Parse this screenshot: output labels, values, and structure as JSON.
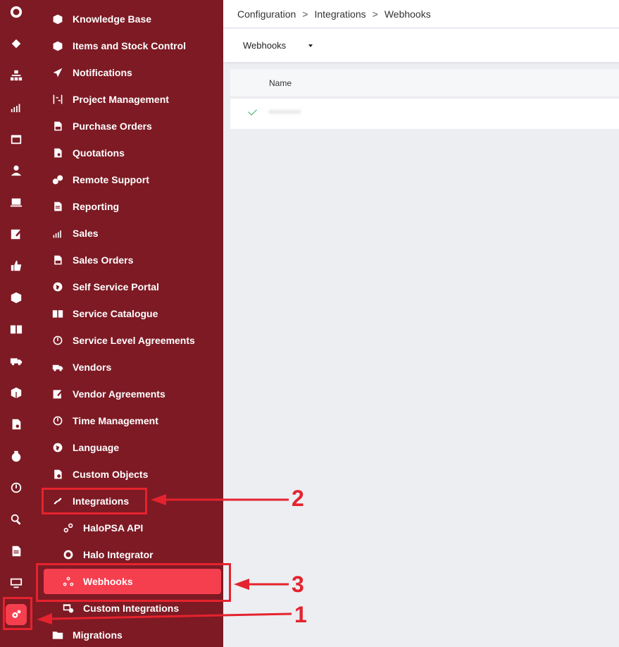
{
  "breadcrumb": [
    "Configuration",
    "Integrations",
    "Webhooks"
  ],
  "toolbar": {
    "dropdown_label": "Webhooks"
  },
  "table": {
    "columns": [
      "Name"
    ],
    "rows": [
      {
        "status": "check-icon",
        "name": "********"
      }
    ]
  },
  "rail": {
    "icons": [
      "halo-logo-icon",
      "ticket-icon",
      "org-chart-icon",
      "chart-icon",
      "calendar-icon",
      "user-icon",
      "laptop-icon",
      "edit-icon",
      "thumbs-up-icon",
      "box-icon",
      "book-icon",
      "truck-icon",
      "cube-icon",
      "document-icon",
      "money-bag-icon",
      "clock-icon",
      "search-icon",
      "report-icon",
      "monitor-icon",
      "gear-icon"
    ]
  },
  "nav": {
    "items": [
      {
        "label": "Knowledge Base",
        "icon": "box-icon"
      },
      {
        "label": "Items and Stock Control",
        "icon": "cube-icon"
      },
      {
        "label": "Notifications",
        "icon": "send-icon"
      },
      {
        "label": "Project Management",
        "icon": "project-icon"
      },
      {
        "label": "Purchase Orders",
        "icon": "po-icon"
      },
      {
        "label": "Quotations",
        "icon": "quote-icon"
      },
      {
        "label": "Remote Support",
        "icon": "remote-icon"
      },
      {
        "label": "Reporting",
        "icon": "report-icon"
      },
      {
        "label": "Sales",
        "icon": "chart-icon"
      },
      {
        "label": "Sales Orders",
        "icon": "so-icon"
      },
      {
        "label": "Self Service Portal",
        "icon": "globe-icon"
      },
      {
        "label": "Service Catalogue",
        "icon": "book-icon"
      },
      {
        "label": "Service Level Agreements",
        "icon": "timer-icon"
      },
      {
        "label": "Vendors",
        "icon": "truck-icon"
      },
      {
        "label": "Vendor Agreements",
        "icon": "edit-icon"
      },
      {
        "label": "Time Management",
        "icon": "clock-icon"
      },
      {
        "label": "Language",
        "icon": "globe-icon"
      },
      {
        "label": "Custom Objects",
        "icon": "custom-object-icon"
      },
      {
        "label": "Integrations",
        "icon": "link-icon"
      },
      {
        "label": "HaloPSA API",
        "icon": "api-icon"
      },
      {
        "label": "Halo Integrator",
        "icon": "circle-icon"
      },
      {
        "label": "Webhooks",
        "icon": "webhook-icon"
      },
      {
        "label": "Custom Integrations",
        "icon": "grid-gear-icon"
      },
      {
        "label": "Migrations",
        "icon": "folder-icon"
      }
    ]
  },
  "annotations": {
    "one": "1",
    "two": "2",
    "three": "3"
  },
  "colors": {
    "sidebar": "#7d1a24",
    "active": "#f53f4f",
    "annotation": "#e5232e"
  }
}
